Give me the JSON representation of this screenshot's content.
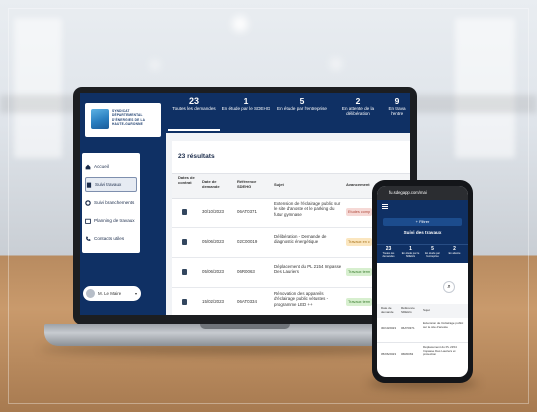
{
  "laptop": {
    "logo_text": "SYNDICAT DÉPARTEMENTAL D'ÉNERGIES DE LA HAUTE-GARONNE",
    "logo_acronym": "SDEHG",
    "menu": [
      {
        "label": "Accueil",
        "icon": "home-icon"
      },
      {
        "label": "Suivi travaux",
        "icon": "clipboard-icon"
      },
      {
        "label": "Suivi branchements",
        "icon": "gear-icon"
      },
      {
        "label": "Planning de travaux",
        "icon": "calendar-icon"
      },
      {
        "label": "Contacts utiles",
        "icon": "phone-icon"
      }
    ],
    "user": "M. Le Maire",
    "tabs": [
      {
        "count": "23",
        "label": "Toutes les demandes"
      },
      {
        "count": "1",
        "label": "En étude par le SDEHG"
      },
      {
        "count": "5",
        "label": "En étude par l'entreprise"
      },
      {
        "count": "2",
        "label": "En attente de la délibération"
      },
      {
        "count": "9",
        "label": "En trava l'entre"
      }
    ],
    "results": "23 résultats",
    "columns": [
      "Dates de contrat",
      "Date de demande",
      "Référence SDEHG",
      "Sujet",
      "Avancement"
    ],
    "rows": [
      {
        "date": "30/10/2023",
        "ref": "06AT0371",
        "subject": "Extension de l'éclairage public sur le site d'anoste et le parking du futur gymnase",
        "status": "Etudes comp",
        "status_color": "#f6d9d6"
      },
      {
        "date": "05/06/2023",
        "ref": "02C00019",
        "subject": "Délibération - Demande de diagnostic énergétique",
        "status": "Travaux en c",
        "status_color": "#fbe6bf"
      },
      {
        "date": "05/06/2023",
        "ref": "06R0063",
        "subject": "Déplacement du PL 2154 Impasse Des Lauriers",
        "status": "Travaux term",
        "status_color": "#d7efcf"
      },
      {
        "date": "15/02/2023",
        "ref": "06AT0334",
        "subject": "Rénovation des appareils d'éclairage public vétustes - programme LED ++",
        "status": "Travaux term",
        "status_color": "#d7efcf"
      }
    ]
  },
  "phone": {
    "url": "fu.sdegapp.com/mai",
    "filter_button": "+ Filtrer",
    "title": "Suivi des travaux",
    "tabs": [
      {
        "count": "23",
        "label": "Toutes les demandes"
      },
      {
        "count": "1",
        "label": "En étude par le SDEHG"
      },
      {
        "count": "5",
        "label": "En étude par l'entreprise"
      },
      {
        "count": "2",
        "label": "En attente"
      }
    ],
    "columns": [
      "Date de demande",
      "Référence SDEHG",
      "Sujet"
    ],
    "rows": [
      {
        "date": "30/10/2023",
        "ref": "06AT0371",
        "subject": "Extension de l'éclairage public sur le site d'anoste"
      },
      {
        "date": "05/06/2023",
        "ref": "06R0063",
        "subject": "Déplacement du PL 2154 Impasse Des Lauriers et protection"
      }
    ]
  }
}
